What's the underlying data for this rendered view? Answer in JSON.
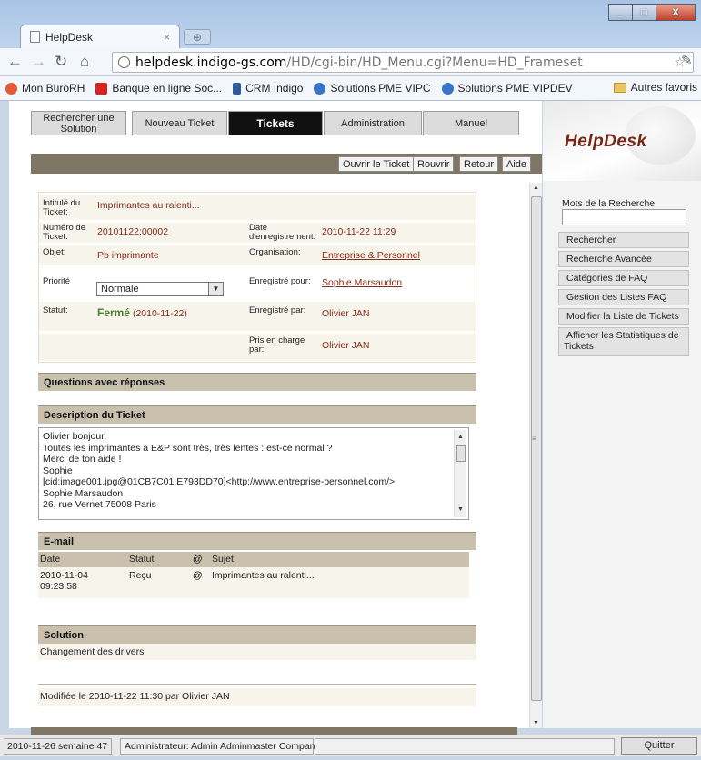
{
  "browser": {
    "tab_title": "HelpDesk",
    "tab_close": "×",
    "url_host": "helpdesk.indigo-gs.com",
    "url_path": "/HD/cgi-bin/HD_Menu.cgi?Menu=HD_Frameset",
    "window_controls": [
      "_",
      "□",
      "X"
    ],
    "bookmarks": [
      {
        "label": "Mon BuroRH",
        "color": "#e45b3a"
      },
      {
        "label": "Banque en ligne Soc...",
        "color": "#d52421"
      },
      {
        "label": "CRM Indigo",
        "color": "#2d5b9a"
      },
      {
        "label": "Solutions PME VIPC",
        "color": "#3776c6"
      },
      {
        "label": "Solutions PME VIPDEV",
        "color": "#3776c6"
      }
    ],
    "bookmarks_more": "»",
    "other_bookmarks": "Autres favoris"
  },
  "nav": {
    "tabs": [
      {
        "label": "Rechercher une Solution",
        "active": false
      },
      {
        "label": "Nouveau Ticket",
        "active": false
      },
      {
        "label": "Tickets",
        "active": true
      },
      {
        "label": "Administration",
        "active": false
      },
      {
        "label": "Manuel",
        "active": false
      }
    ]
  },
  "actions": {
    "open_ticket": "Ouvrir le Ticket",
    "reopen": "Rouvrir",
    "back": "Retour",
    "help": "Aide"
  },
  "ticket": {
    "title_label": "Intitulé du Ticket:",
    "title_value": "Imprimantes au ralenti...",
    "number_label": "Numéro de Ticket:",
    "number_value": "20101122:00002",
    "date_label": "Date d'enregistrement:",
    "date_value": "2010-11-22 11:29",
    "object_label": "Objet:",
    "object_value": "Pb imprimante",
    "org_label": "Organisation:",
    "org_value": "Entreprise & Personnel",
    "priority_label": "Priorité",
    "priority_value": "Normale",
    "registered_for_label": "Enregistré pour:",
    "registered_for_value": "Sophie Marsaudon",
    "status_label": "Statut:",
    "status_word": "Fermé",
    "status_date": "(2010-11-22)",
    "registered_by_label": "Enregistré par:",
    "registered_by_value": "Olivier JAN",
    "handled_by_label": "Pris en charge par:",
    "handled_by_value": "Olivier JAN"
  },
  "sections": {
    "questions": "Questions avec réponses",
    "description": "Description du Ticket",
    "email": "E-mail",
    "solution": "Solution"
  },
  "description_lines": [
    "Olivier bonjour,",
    "Toutes les imprimantes à E&P sont très, très lentes : est-ce normal ?",
    "Merci de ton aide !",
    "Sophie",
    "[cid:image001.jpg@01CB7C01.E793DD70]<http://www.entreprise-personnel.com/>",
    "Sophie Marsaudon",
    "26, rue Vernet 75008 Paris"
  ],
  "email": {
    "headers": {
      "date": "Date",
      "status": "Statut",
      "attach": "@",
      "subject": "Sujet"
    },
    "rows": [
      {
        "date": "2010-11-04",
        "time": "09:23:58",
        "status": "Reçu",
        "attach": "@",
        "subject": "Imprimantes au ralenti..."
      }
    ]
  },
  "solution_text": "Changement des drivers",
  "modified_text": "Modifiée le 2010-11-22 11:30 par Olivier JAN",
  "sidebar": {
    "logo": "HelpDesk",
    "search_label": "Mots de la Recherche",
    "buttons": [
      "Rechercher",
      "Recherche Avancée",
      "Catégories de FAQ",
      "Gestion des Listes FAQ",
      "Modifier la Liste de Tickets",
      "Afficher les Statistiques de Tickets"
    ]
  },
  "statusbar": {
    "date_week": "2010-11-26  semaine 47",
    "admin": "Administrateur: Admin Adminmaster Company",
    "quit": "Quitter"
  }
}
